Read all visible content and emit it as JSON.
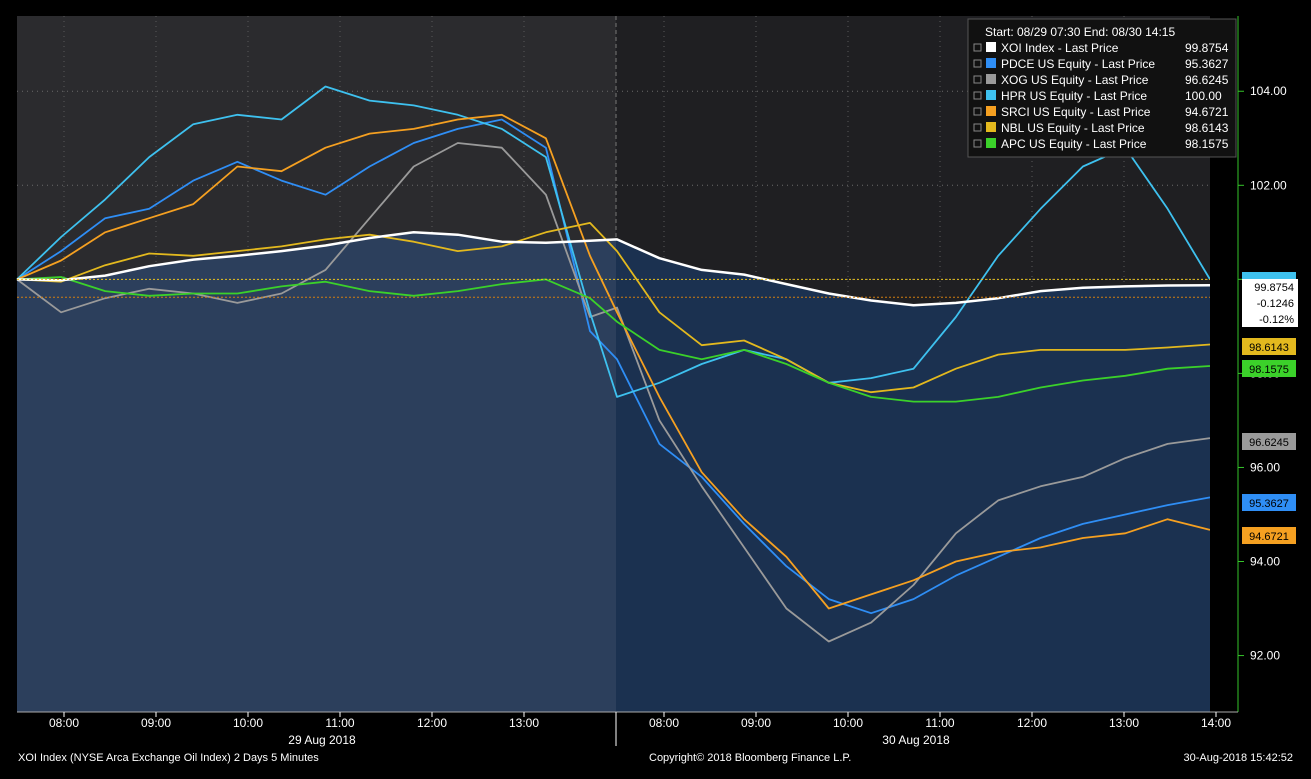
{
  "chart_data": {
    "type": "line",
    "legend_header": "Start: 08/29 07:30 End: 08/30 14:15",
    "legend_placement": "top-right",
    "y_range": [
      90.8,
      105.6
    ],
    "y_ticks": [
      "92.00",
      "94.00",
      "96.00",
      "98.00",
      "100.00",
      "102.00",
      "104.00"
    ],
    "y_tick_values": [
      92,
      94,
      96,
      98,
      100,
      102,
      104
    ],
    "x_ticks_day1": [
      "08:00",
      "09:00",
      "10:00",
      "11:00",
      "12:00",
      "13:00"
    ],
    "x_ticks_day2": [
      "08:00",
      "09:00",
      "10:00",
      "11:00",
      "12:00",
      "13:00",
      "14:00"
    ],
    "day_labels": [
      "29 Aug 2018",
      "30 Aug 2018"
    ],
    "grid": true,
    "reference_line": 99.8754,
    "change_values": [
      "99.8754",
      "-0.1246",
      "-0.12%"
    ],
    "series": [
      {
        "name": "XOI Index - Last Price",
        "last": "99.8754",
        "color": "#ffffff",
        "day1": [
          100.0,
          99.98,
          100.08,
          100.28,
          100.42,
          100.5,
          100.6,
          100.72,
          100.88,
          101.0,
          100.95,
          100.8,
          100.78,
          100.82
        ],
        "day2": [
          100.85,
          100.45,
          100.2,
          100.1,
          99.9,
          99.7,
          99.55,
          99.45,
          99.5,
          99.6,
          99.75,
          99.82,
          99.85,
          99.87,
          99.8754
        ]
      },
      {
        "name": "PDCE US Equity - Last Price",
        "last": "95.3627",
        "color": "#2f8ef5",
        "day1": [
          100.0,
          100.6,
          101.3,
          101.5,
          102.1,
          102.5,
          102.1,
          101.8,
          102.4,
          102.9,
          103.2,
          103.4,
          102.8,
          98.9
        ],
        "day2": [
          98.3,
          96.5,
          95.8,
          94.8,
          93.9,
          93.2,
          92.9,
          93.2,
          93.7,
          94.1,
          94.5,
          94.8,
          95.0,
          95.2,
          95.3627
        ]
      },
      {
        "name": "XOG US Equity - Last Price",
        "last": "96.6245",
        "color": "#9a9a9a",
        "day1": [
          100.0,
          99.3,
          99.6,
          99.8,
          99.7,
          99.5,
          99.7,
          100.2,
          101.3,
          102.4,
          102.9,
          102.8,
          101.8,
          99.2
        ],
        "day2": [
          99.4,
          97.0,
          95.6,
          94.3,
          93.0,
          92.3,
          92.7,
          93.5,
          94.6,
          95.3,
          95.6,
          95.8,
          96.2,
          96.5,
          96.6245
        ]
      },
      {
        "name": "HPR US Equity - Last Price",
        "last": "100.00",
        "color": "#3ec1ef",
        "day1": [
          100.0,
          100.9,
          101.7,
          102.6,
          103.3,
          103.5,
          103.4,
          104.1,
          103.8,
          103.7,
          103.5,
          103.2,
          102.6,
          99.3
        ],
        "day2": [
          97.5,
          97.8,
          98.2,
          98.5,
          98.3,
          97.8,
          97.9,
          98.1,
          99.2,
          100.5,
          101.5,
          102.4,
          102.8,
          101.5,
          100.0
        ]
      },
      {
        "name": "SRCI US Equity - Last Price",
        "last": "94.6721",
        "color": "#f5a021",
        "day1": [
          100.0,
          100.4,
          101.0,
          101.3,
          101.6,
          102.4,
          102.3,
          102.8,
          103.1,
          103.2,
          103.4,
          103.5,
          103.0,
          100.5
        ],
        "day2": [
          99.3,
          97.5,
          95.9,
          94.9,
          94.1,
          93.0,
          93.3,
          93.6,
          94.0,
          94.2,
          94.3,
          94.5,
          94.6,
          94.9,
          94.6721
        ]
      },
      {
        "name": "NBL US Equity - Last Price",
        "last": "98.6143",
        "color": "#e3b91e",
        "day1": [
          100.0,
          99.95,
          100.3,
          100.55,
          100.5,
          100.6,
          100.7,
          100.85,
          100.95,
          100.8,
          100.6,
          100.7,
          101.0,
          101.2
        ],
        "day2": [
          100.6,
          99.3,
          98.6,
          98.7,
          98.3,
          97.8,
          97.6,
          97.7,
          98.1,
          98.4,
          98.5,
          98.5,
          98.5,
          98.55,
          98.6143
        ]
      },
      {
        "name": "APC US Equity - Last Price",
        "last": "98.1575",
        "color": "#3bd12a",
        "day1": [
          100.0,
          100.05,
          99.75,
          99.65,
          99.7,
          99.7,
          99.85,
          99.95,
          99.75,
          99.65,
          99.75,
          99.9,
          100.0,
          99.6
        ],
        "day2": [
          99.1,
          98.5,
          98.3,
          98.5,
          98.2,
          97.8,
          97.5,
          97.4,
          97.4,
          97.5,
          97.7,
          97.85,
          97.95,
          98.1,
          98.1575
        ]
      }
    ]
  },
  "footer": {
    "left": "XOI Index (NYSE Arca Exchange Oil Index) 2 Days 5 Minutes",
    "center": "Copyright© 2018 Bloomberg Finance L.P.",
    "right": "30-Aug-2018 15:42:52"
  },
  "colors": {
    "background": "#000000",
    "day1_background": "#2b2b2e",
    "day2_background": "#1f1f22",
    "area_day1": "#2c3f5c",
    "area_day2": "#1b3150",
    "reference_dotted": "#e9c21c",
    "axis_green": "#35c52a"
  }
}
